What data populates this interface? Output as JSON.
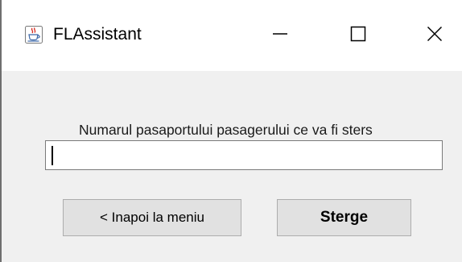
{
  "window": {
    "title": "FLAssistant",
    "app_icon": "java-coffee-cup-icon",
    "controls": {
      "minimize": "minimize-icon",
      "maximize": "maximize-icon",
      "close": "close-icon"
    }
  },
  "form": {
    "label": "Numarul pasaportului pasagerului ce va fi sters",
    "passport_input": {
      "value": "",
      "placeholder": ""
    }
  },
  "buttons": {
    "back_label": "< Inapoi la meniu",
    "delete_label": "Sterge"
  },
  "colors": {
    "titlebar_bg": "#ffffff",
    "client_bg": "#f0f0f0",
    "button_bg": "#e1e1e1",
    "button_border": "#adadad",
    "input_border": "#7a7a7a"
  }
}
